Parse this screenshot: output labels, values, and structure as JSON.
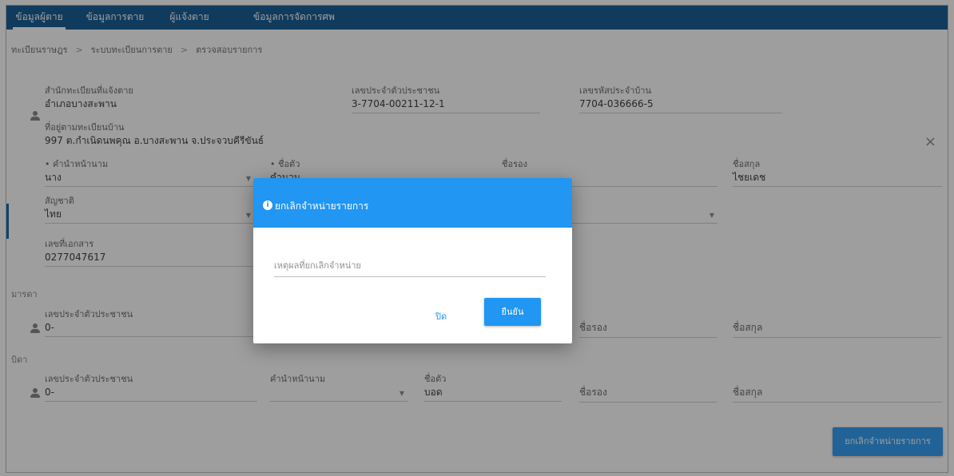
{
  "nav": {
    "tabs": [
      {
        "label": "ข้อมูลผู้ตาย"
      },
      {
        "label": "ข้อมูลการตาย"
      },
      {
        "label": "ผู้แจ้งตาย"
      },
      {
        "label": "ข้อมูลการจัดการศพ"
      }
    ]
  },
  "breadcrumb": [
    "ทะเบียนราษฎร",
    "ระบบทะเบียนการตาย",
    "ตรวจสอบรายการ"
  ],
  "deceased": {
    "registry_office": {
      "label": "สำนักทะเบียนที่แจ้งตาย",
      "value": "อำเภอบางสะพาน"
    },
    "id_number": {
      "label": "เลขประจำตัวประชาชน",
      "value": "3-7704-00211-12-1"
    },
    "house_code": {
      "label": "เลขรหัสประจำบ้าน",
      "value": "7704-036666-5"
    },
    "address": {
      "label": "ที่อยู่ตามทะเบียนบ้าน",
      "value": "997 ต.กำเนิดนพคุณ อ.บางสะพาน จ.ประจวบคีรีขันธ์"
    },
    "title": {
      "label": "• คำนำหน้านาม",
      "value": "นาง"
    },
    "first_name": {
      "label": "• ชื่อตัว",
      "value": "คำนวน"
    },
    "middle_name": {
      "label": "ชื่อรอง",
      "value": ""
    },
    "last_name": {
      "label": "ชื่อสกุล",
      "value": "ไชยเดช"
    },
    "nationality": {
      "label": "สัญชาติ",
      "value": "ไทย"
    },
    "document_no": {
      "label": "เลขที่เอกสาร",
      "value": "0277047617"
    }
  },
  "mother": {
    "section": "มารดา",
    "id_number": {
      "label": "เลขประจำตัวประชาชน",
      "value": "0-"
    },
    "middle_name": {
      "label": "ชื่อรอง"
    },
    "last_name": {
      "label": "ชื่อสกุล"
    }
  },
  "father": {
    "section": "บิดา",
    "id_number": {
      "label": "เลขประจำตัวประชาชน",
      "value": "0-"
    },
    "title": {
      "label": "คำนำหน้านาม",
      "value": ""
    },
    "first_name": {
      "label": "ชื่อตัว",
      "value": "บอด"
    },
    "middle_name": {
      "label": "ชื่อรอง"
    },
    "last_name": {
      "label": "ชื่อสกุล"
    }
  },
  "actions": {
    "cancel_disposal": "ยกเลิกจำหน่ายรายการ",
    "close_icon": "×"
  },
  "dialog": {
    "title": "ยกเลิกจำหน่ายรายการ",
    "icon": "info-icon",
    "reason_placeholder": "เหตุผลที่ยกเลิกจำหน่าย",
    "reason_value": "",
    "close_label": "ปิด",
    "confirm_label": "ยืนยัน"
  },
  "colors": {
    "nav": "#1c5f97",
    "accent": "#2196f3"
  }
}
